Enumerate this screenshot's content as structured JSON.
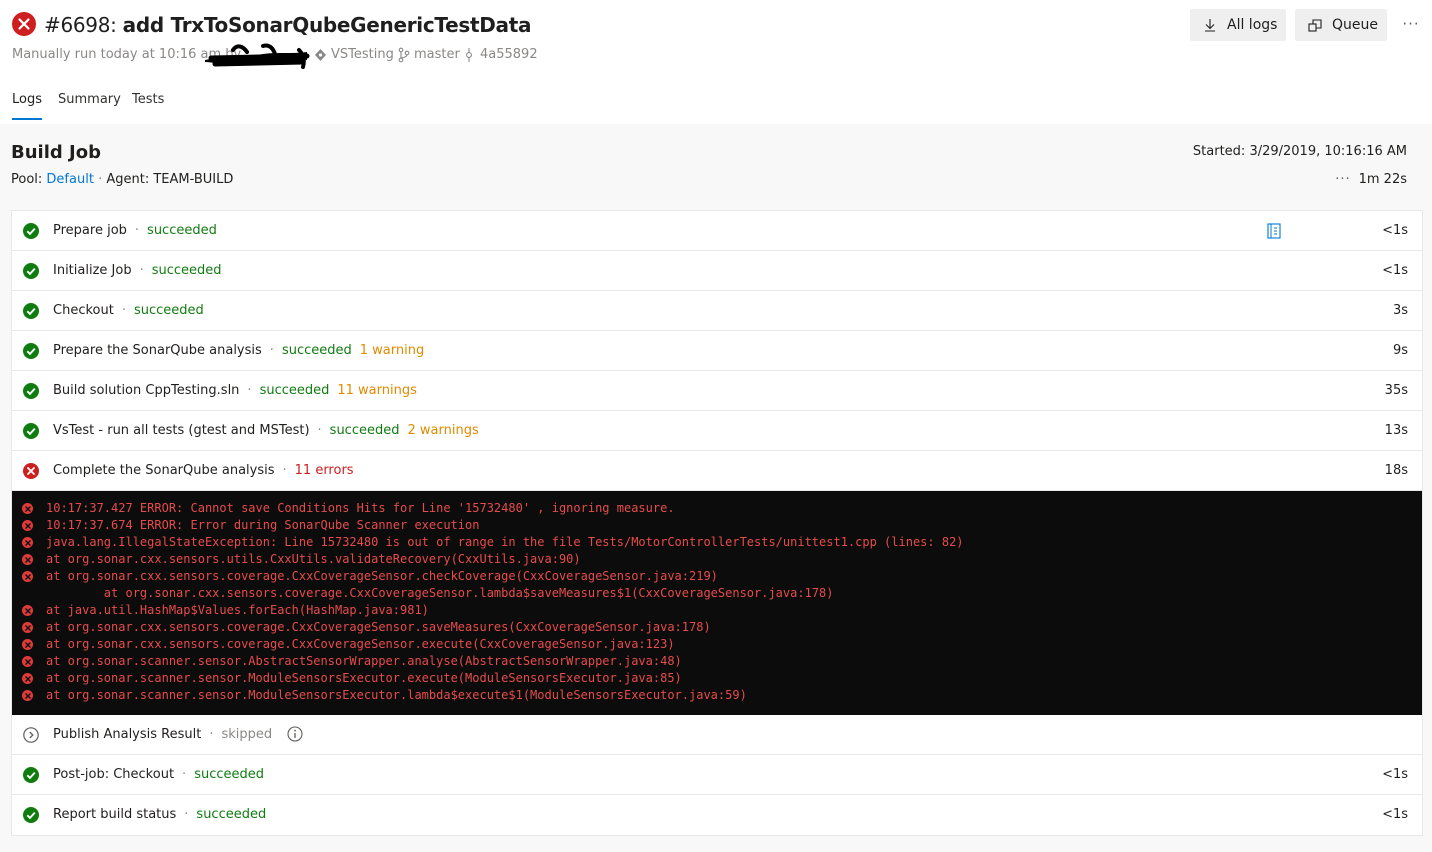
{
  "header": {
    "build_number": "#6698:",
    "build_name": "add TrxToSonarQubeGenericTestData",
    "trigger_text": "Manually run today at 10:16 am by",
    "repo": "VSTesting",
    "branch": "master",
    "commit": "4a55892",
    "all_logs_label": "All logs",
    "queue_label": "Queue",
    "more_label": "···"
  },
  "tabs": [
    {
      "label": "Logs"
    },
    {
      "label": "Summary"
    },
    {
      "label": "Tests"
    }
  ],
  "job": {
    "title": "Build Job",
    "pool_label": "Pool:",
    "pool_value": "Default",
    "separator": "·",
    "agent_text": "Agent: TEAM-BUILD",
    "started_text": "Started: 3/29/2019, 10:16:16 AM",
    "duration_dots": "···",
    "duration_total": "1m 22s"
  },
  "steps": [
    {
      "name": "Prepare job",
      "status": "succeeded",
      "extra": "",
      "duration": "<1s"
    },
    {
      "name": "Initialize Job",
      "status": "succeeded",
      "extra": "",
      "duration": "<1s"
    },
    {
      "name": "Checkout",
      "status": "succeeded",
      "extra": "",
      "duration": "3s"
    },
    {
      "name": "Prepare the SonarQube analysis",
      "status": "succeeded",
      "extra": "1 warning",
      "duration": "9s"
    },
    {
      "name": "Build solution CppTesting.sln",
      "status": "succeeded",
      "extra": "11 warnings",
      "duration": "35s"
    },
    {
      "name": "VsTest - run all tests (gtest and MSTest)",
      "status": "succeeded",
      "extra": "2 warnings",
      "duration": "13s"
    },
    {
      "name": "Complete the SonarQube analysis",
      "status": "11 errors",
      "extra": "",
      "duration": "18s"
    },
    {
      "name": "Publish Analysis Result",
      "status": "skipped",
      "extra": "",
      "duration": ""
    },
    {
      "name": "Post-job: Checkout",
      "status": "succeeded",
      "extra": "",
      "duration": "<1s"
    },
    {
      "name": "Report build status",
      "status": "succeeded",
      "extra": "",
      "duration": "<1s"
    }
  ],
  "log_lines": [
    {
      "text": "10:17:37.427 ERROR: Cannot save Conditions Hits for Line '15732480' , ignoring measure.",
      "icon": true
    },
    {
      "text": "10:17:37.674 ERROR: Error during SonarQube Scanner execution",
      "icon": true
    },
    {
      "text": "java.lang.IllegalStateException: Line 15732480 is out of range in the file Tests/MotorControllerTests/unittest1.cpp (lines: 82)",
      "icon": true
    },
    {
      "text": "at org.sonar.cxx.sensors.utils.CxxUtils.validateRecovery(CxxUtils.java:90)",
      "icon": true
    },
    {
      "text": "at org.sonar.cxx.sensors.coverage.CxxCoverageSensor.checkCoverage(CxxCoverageSensor.java:219)",
      "icon": true
    },
    {
      "text": "        at org.sonar.cxx.sensors.coverage.CxxCoverageSensor.lambda$saveMeasures$1(CxxCoverageSensor.java:178)",
      "icon": false
    },
    {
      "text": "at java.util.HashMap$Values.forEach(HashMap.java:981)",
      "icon": true
    },
    {
      "text": "at org.sonar.cxx.sensors.coverage.CxxCoverageSensor.saveMeasures(CxxCoverageSensor.java:178)",
      "icon": true
    },
    {
      "text": "at org.sonar.cxx.sensors.coverage.CxxCoverageSensor.execute(CxxCoverageSensor.java:123)",
      "icon": true
    },
    {
      "text": "at org.sonar.scanner.sensor.AbstractSensorWrapper.analyse(AbstractSensorWrapper.java:48)",
      "icon": true
    },
    {
      "text": "at org.sonar.scanner.sensor.ModuleSensorsExecutor.execute(ModuleSensorsExecutor.java:85)",
      "icon": true
    },
    {
      "text": "at org.sonar.scanner.sensor.ModuleSensorsExecutor.lambda$execute$1(ModuleSensorsExecutor.java:59)",
      "icon": true
    }
  ],
  "colors": {
    "success": "#107c10",
    "warning": "#e08a00",
    "error": "#cd1f1f",
    "accent": "#0078d4",
    "log_background": "#0c0c0c"
  }
}
